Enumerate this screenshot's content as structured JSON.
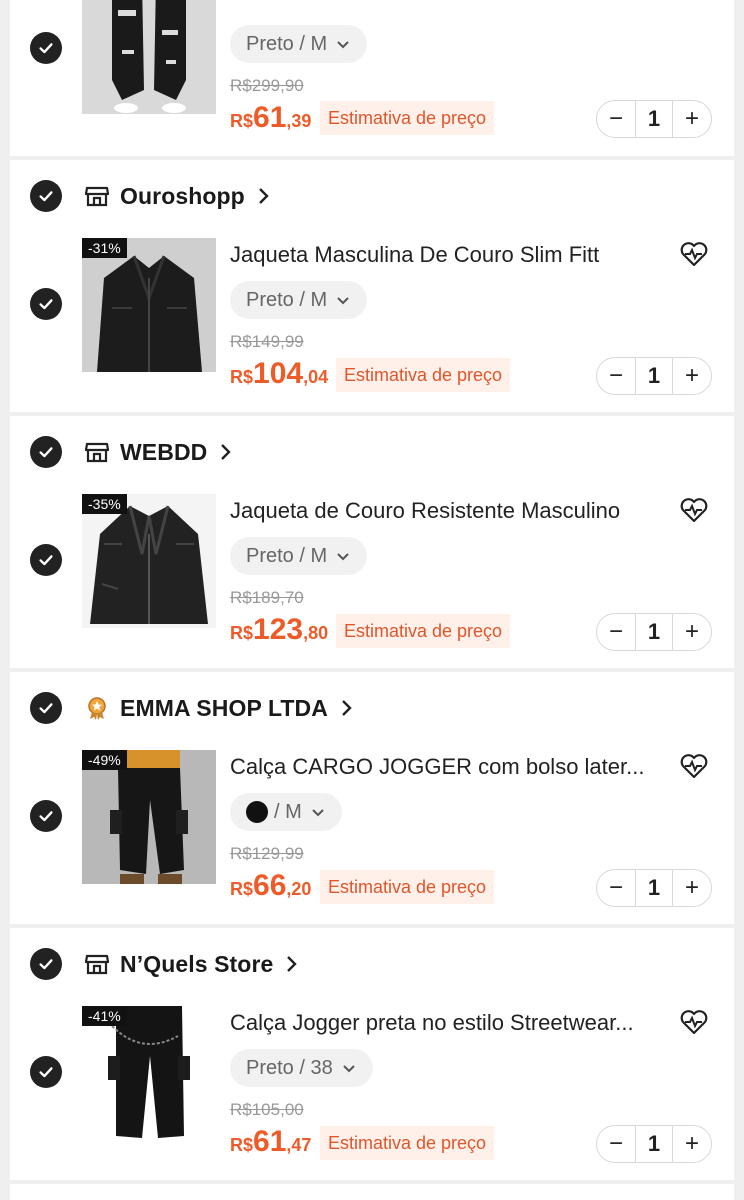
{
  "colors": {
    "accent": "#ee5a28",
    "estimate_bg": "#fff0ea",
    "check": "#222222"
  },
  "top_item": {
    "variant": "Preto / M",
    "old_price": "R$299,90",
    "price_currency": "R$",
    "price_int": "61",
    "price_dec": ",39",
    "estimate": "Estimativa de preço",
    "qty": "1"
  },
  "stores": [
    {
      "store_icon": "store-icon",
      "name": "Ouroshopp",
      "discount": "-31%",
      "title": "Jaqueta Masculina De Couro Slim Fitt",
      "variant": "Preto / M",
      "old_price": "R$149,99",
      "price_currency": "R$",
      "price_int": "104",
      "price_dec": ",04",
      "estimate": "Estimativa de preço",
      "qty": "1"
    },
    {
      "store_icon": "store-icon",
      "name": "WEBDD",
      "discount": "-35%",
      "title": "Jaqueta de Couro Resistente Masculino",
      "variant": "Preto / M",
      "old_price": "R$189,70",
      "price_currency": "R$",
      "price_int": "123",
      "price_dec": ",80",
      "estimate": "Estimativa de preço",
      "qty": "1"
    },
    {
      "store_icon": "medal-icon",
      "name": "EMMA SHOP LTDA",
      "discount": "-49%",
      "title": "Calça CARGO JOGGER com bolso later...",
      "variant": "/ M",
      "old_price": "R$129,99",
      "price_currency": "R$",
      "price_int": "66",
      "price_dec": ",20",
      "estimate": "Estimativa de preço",
      "qty": "1"
    },
    {
      "store_icon": "store-icon",
      "name": "N’Quels Store",
      "discount": "-41%",
      "title": "Calça Jogger preta no estilo Streetwear...",
      "variant": "Preto / 38",
      "old_price": "R$105,00",
      "price_currency": "R$",
      "price_int": "61",
      "price_dec": ",47",
      "estimate": "Estimativa de preço",
      "qty": "1"
    }
  ]
}
